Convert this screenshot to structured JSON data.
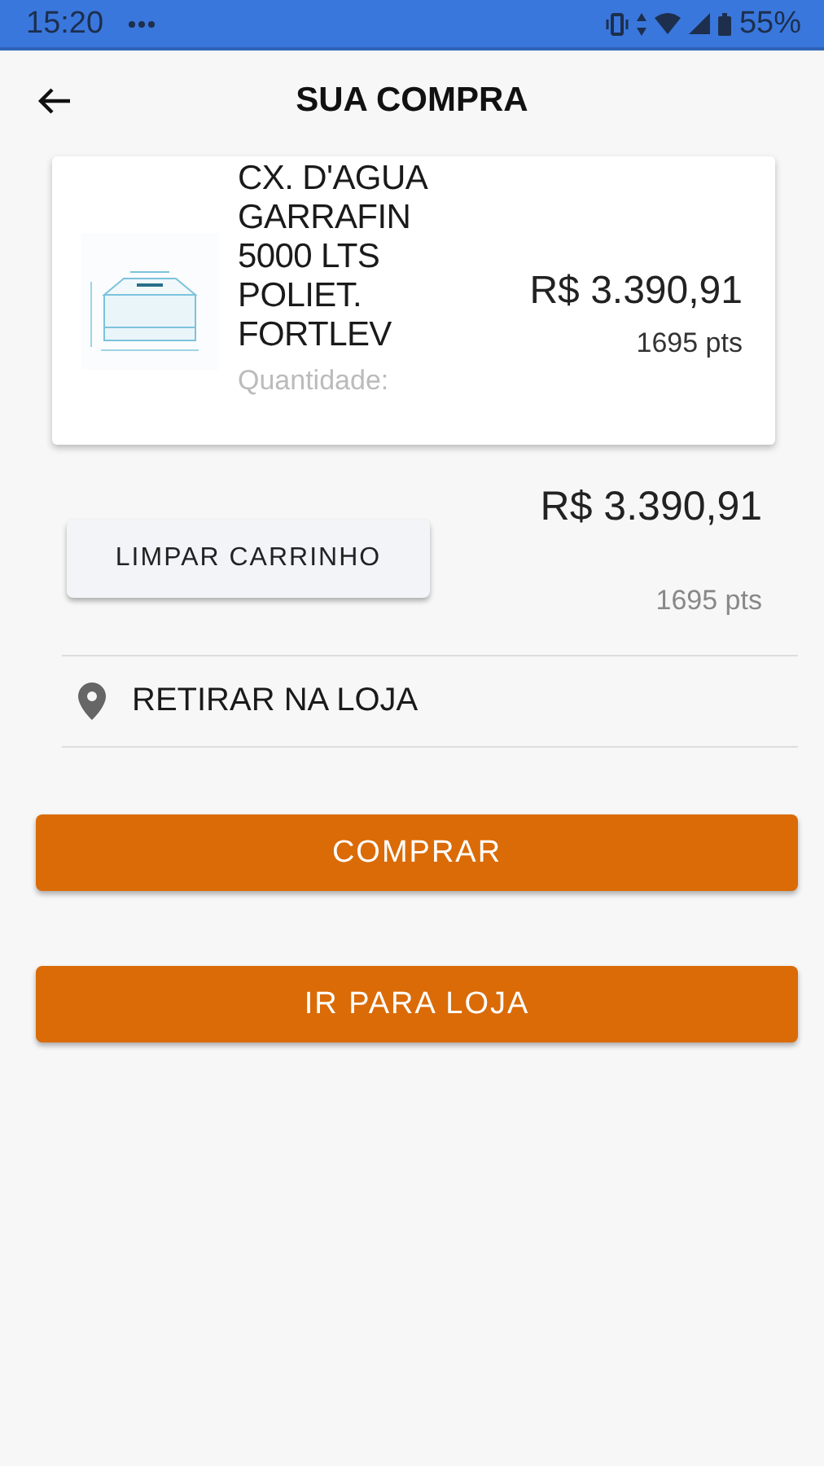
{
  "status_bar": {
    "time": "15:20",
    "battery": "55%"
  },
  "header": {
    "title": "SUA COMPRA"
  },
  "cart": {
    "items": [
      {
        "name_lines": [
          "CX. D'AGUA",
          "GARRAFIN",
          "5000 LTS",
          "POLIET.",
          "FORTLEV"
        ],
        "quantity": "Quantidade:",
        "price": "R$ 3.390,91",
        "points": "1695 pts"
      }
    ]
  },
  "summary": {
    "total": "R$ 3.390,91",
    "points": "1695 pts",
    "clear_button": "LIMPAR CARRINHO"
  },
  "delivery": {
    "label": "RETIRAR NA LOJA"
  },
  "buttons": [
    {
      "label": "COMPRAR"
    },
    {
      "label": "IR PARA LOJA"
    }
  ]
}
